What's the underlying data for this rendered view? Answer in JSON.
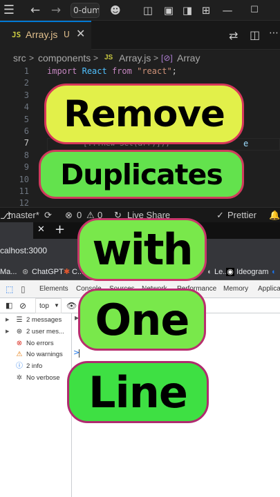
{
  "titlebar": {
    "search_text": "0-dum",
    "icons": [
      "menu-icon",
      "back-arrow-icon",
      "forward-arrow-icon",
      "copilot-icon",
      "layout-icon",
      "panel-icon",
      "split-icon",
      "grid-icon",
      "minimize-icon",
      "maximize-icon"
    ]
  },
  "editor": {
    "tab": {
      "badge": "JS",
      "filename": "Array.js",
      "status": "U",
      "close": "✕"
    },
    "breadcrumb": {
      "part1": "src",
      "sep1": ">",
      "part2": "components",
      "sep2": ">",
      "badge": "JS",
      "file": "Array.js",
      "sep3": ">",
      "symbol_icon": "[⊘]",
      "symbol": "Array"
    },
    "line_numbers": [
      "1",
      "2",
      "3",
      "4",
      "5",
      "6",
      "7",
      "8",
      "9",
      "10",
      "11",
      "12"
    ],
    "current_line": "7",
    "code_line1": {
      "kw": "import",
      "name": "React",
      "kw2": "from",
      "str": "\"react\"",
      "end": ";"
    },
    "code_line7_partial": "e",
    "code_line8_partial": "[...new Set(arr)]);"
  },
  "statusbar": {
    "branch": "master*",
    "sync": "⟳",
    "errors": "0",
    "warnings": "0",
    "live_share": "Live Share",
    "prettier": "Prettier"
  },
  "browser": {
    "new_tab": "+",
    "close_tab": "✕",
    "url": "calhost:3000",
    "bookmarks": [
      "Ma...",
      "ChatGPT",
      "C...",
      "Le...",
      "Ideogram"
    ],
    "devtools_tabs": [
      "Elements",
      "Console",
      "Sources",
      "Network",
      "Performance",
      "Memory",
      "Applica"
    ],
    "context": "top",
    "sidebar": [
      {
        "label": "2 messages",
        "icon": "list-icon",
        "color": "#333333"
      },
      {
        "label": "2 user mes...",
        "icon": "user-icon",
        "color": "#333333"
      },
      {
        "label": "No errors",
        "icon": "error-icon",
        "color": "#d93025"
      },
      {
        "label": "No warnings",
        "icon": "warning-icon",
        "color": "#e37400"
      },
      {
        "label": "2 info",
        "icon": "info-icon",
        "color": "#1a73e8"
      },
      {
        "label": "No verbose",
        "icon": "bug-icon",
        "color": "#555555"
      }
    ],
    "prompt": ">"
  },
  "overlay": {
    "line1": "Remove",
    "line2": "Duplicates",
    "line3": "with",
    "line4": "One",
    "line5": "Line"
  },
  "colors": {
    "accent": "#0078d4",
    "keyword": "#c586c0",
    "identifier": "#4fc1ff",
    "string": "#ce9178",
    "js_badge": "#cbcb41"
  }
}
